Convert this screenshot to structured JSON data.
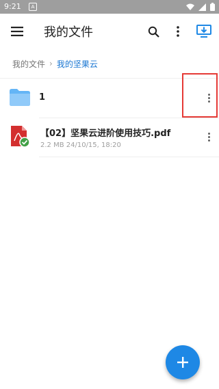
{
  "status_bar": {
    "time": "9:21",
    "notification_glyph": "A"
  },
  "app_bar": {
    "title": "我的文件"
  },
  "breadcrumb": {
    "parent": "我的文件",
    "separator": "›",
    "current": "我的坚果云"
  },
  "files": [
    {
      "name": "1",
      "type": "folder",
      "meta": ""
    },
    {
      "name": "【02】坚果云进阶使用技巧.pdf",
      "type": "pdf",
      "meta": "2.2 MB 24/10/15, 18:20"
    }
  ],
  "colors": {
    "accent": "#1e88e5",
    "folder": "#64b5f6",
    "pdf": "#d32f2f",
    "highlight": "#e53935"
  },
  "icons": [
    "menu-icon",
    "search-icon",
    "more-vert-icon",
    "desktop-sync-icon",
    "folder-icon",
    "pdf-icon",
    "add-icon"
  ]
}
